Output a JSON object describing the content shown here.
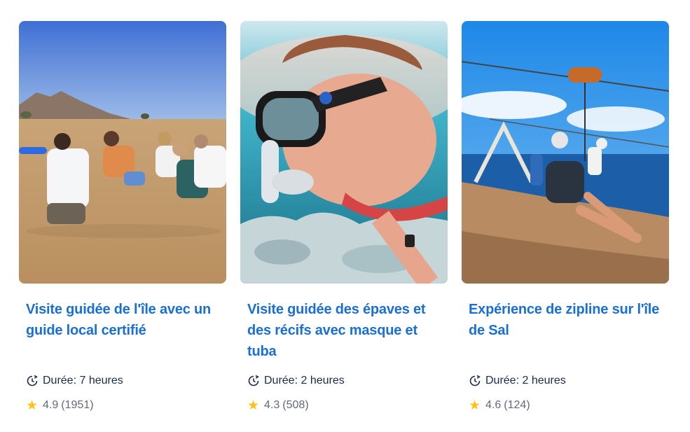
{
  "cards": [
    {
      "title": "Visite guidée de l'île avec un guide local certifié",
      "duration": "Durée: 7 heures",
      "rating": "4.9",
      "reviews": "(1951)",
      "image": "guided-island-tour-photo"
    },
    {
      "title": "Visite guidée des épaves et des récifs avec masque et tuba",
      "duration": "Durée: 2 heures",
      "rating": "4.3",
      "reviews": "(508)",
      "image": "snorkeling-photo"
    },
    {
      "title": "Expérience de zipline sur l'île de Sal",
      "duration": "Durée: 2 heures",
      "rating": "4.6",
      "reviews": "(124)",
      "image": "zipline-photo"
    }
  ],
  "colors": {
    "title": "#1a6fd6",
    "star": "#ffc21a",
    "text": "#1a2b49",
    "muted": "#63687a"
  }
}
